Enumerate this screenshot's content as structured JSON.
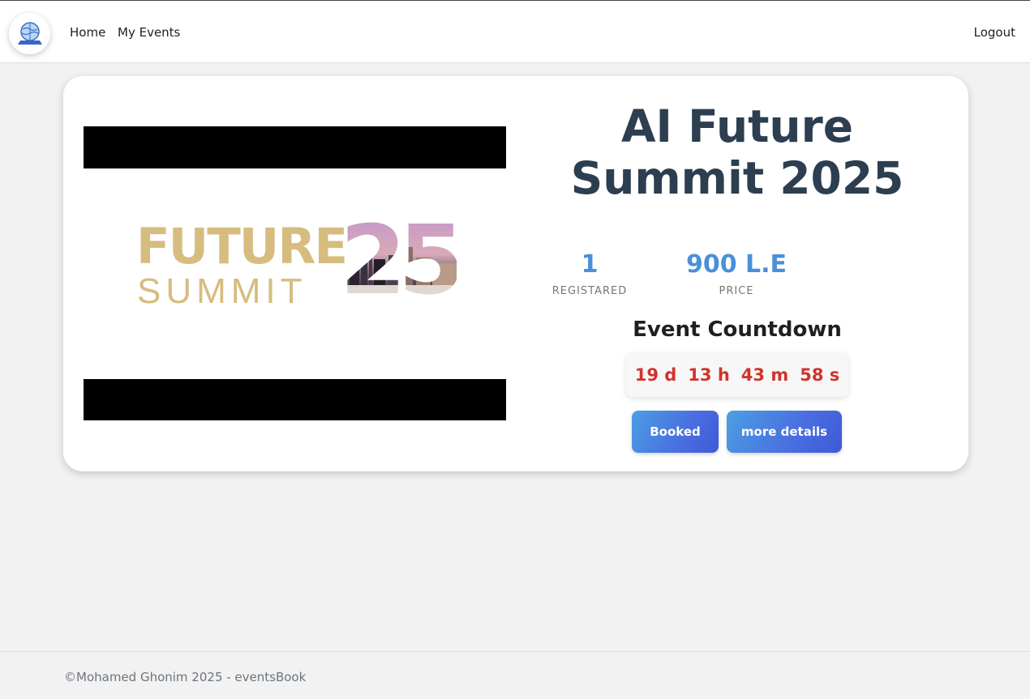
{
  "navbar": {
    "brand_icon": "globe-laptop-logo-icon",
    "links": [
      {
        "label": "Home"
      },
      {
        "label": "My Events"
      }
    ],
    "logout_label": "Logout"
  },
  "event": {
    "banner": {
      "line1": "FUTURE",
      "line2": "SUMMIT",
      "number": "25",
      "brand_color": "#d6bd7f"
    },
    "title": "AI Future Summit 2025",
    "registered": {
      "value": "1",
      "label": "REGISTARED"
    },
    "price": {
      "value": "900 L.E",
      "label": "PRICE"
    },
    "countdown": {
      "title": "Event Countdown",
      "days": "19 d",
      "hours": "13 h",
      "minutes": "43 m",
      "seconds": "58 s"
    },
    "buttons": {
      "booked": "Booked",
      "details": "more details"
    }
  },
  "footer": {
    "text": "©Mohamed Ghonim 2025 - eventsBook"
  },
  "colors": {
    "accent_blue": "#4a90d9",
    "title_dark": "#2c3e50",
    "countdown_red": "#d0342c"
  }
}
